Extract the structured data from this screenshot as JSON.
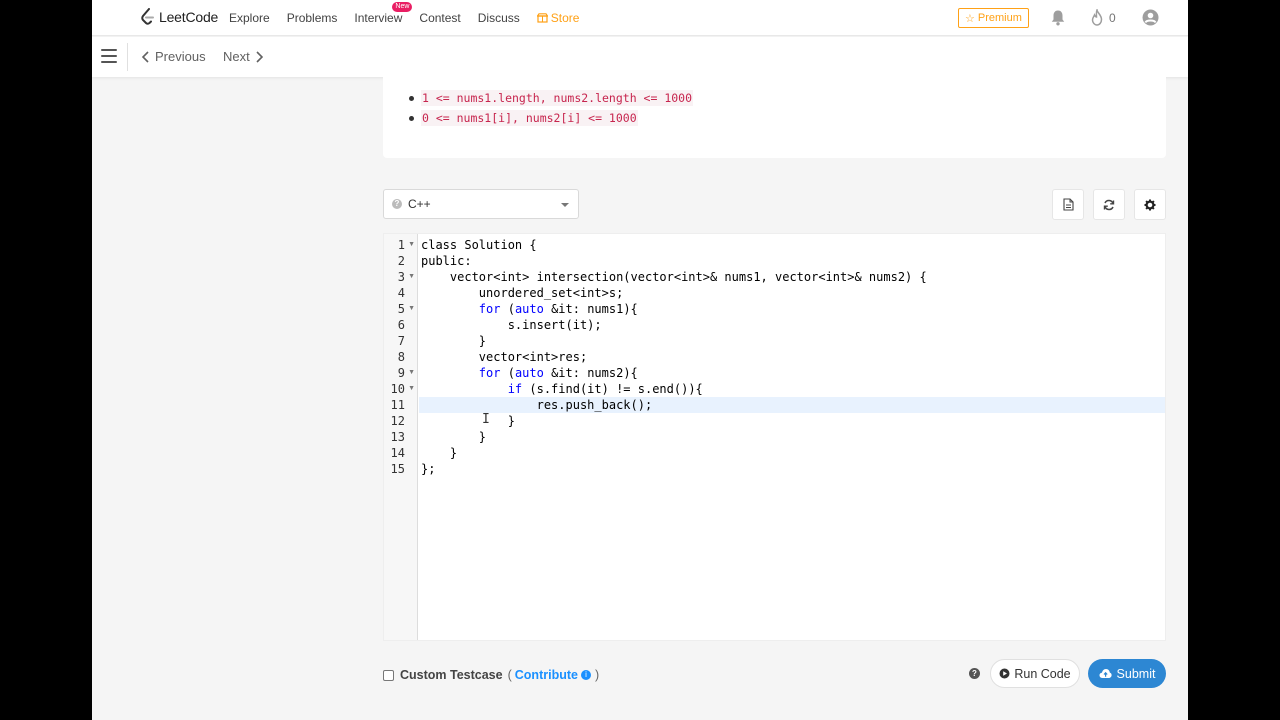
{
  "nav": {
    "logo_text": "LeetCode",
    "links": [
      "Explore",
      "Problems",
      "Interview",
      "Contest",
      "Discuss"
    ],
    "new_badge": "New",
    "store": "Store",
    "premium": "Premium",
    "streak_count": "0",
    "accent_color": "#ffa116"
  },
  "subnav": {
    "previous": "Previous",
    "next": "Next"
  },
  "constraints": [
    "1 <= nums1.length, nums2.length <= 1000",
    "0 <= nums1[i], nums2[i] <= 1000"
  ],
  "editor": {
    "language": "C++",
    "active_line": 11,
    "lines": [
      "class Solution {",
      "public:",
      "    vector<int> intersection(vector<int>& nums1, vector<int>& nums2) {",
      "        unordered_set<int>s;",
      "        for (auto &it: nums1){",
      "            s.insert(it);",
      "        }",
      "        vector<int>res;",
      "        for (auto &it: nums2){",
      "            if (s.find(it) != s.end()){",
      "                res.push_back();",
      "            }",
      "        }",
      "    }",
      "};"
    ],
    "line_numbers": [
      "1",
      "2",
      "3",
      "4",
      "5",
      "6",
      "7",
      "8",
      "9",
      "10",
      "11",
      "12",
      "13",
      "14",
      "15"
    ]
  },
  "bottom": {
    "custom_testcase": "Custom Testcase",
    "open_paren": "(",
    "contribute": "Contribute",
    "close_paren": ")",
    "run_code": "Run Code",
    "submit": "Submit"
  }
}
